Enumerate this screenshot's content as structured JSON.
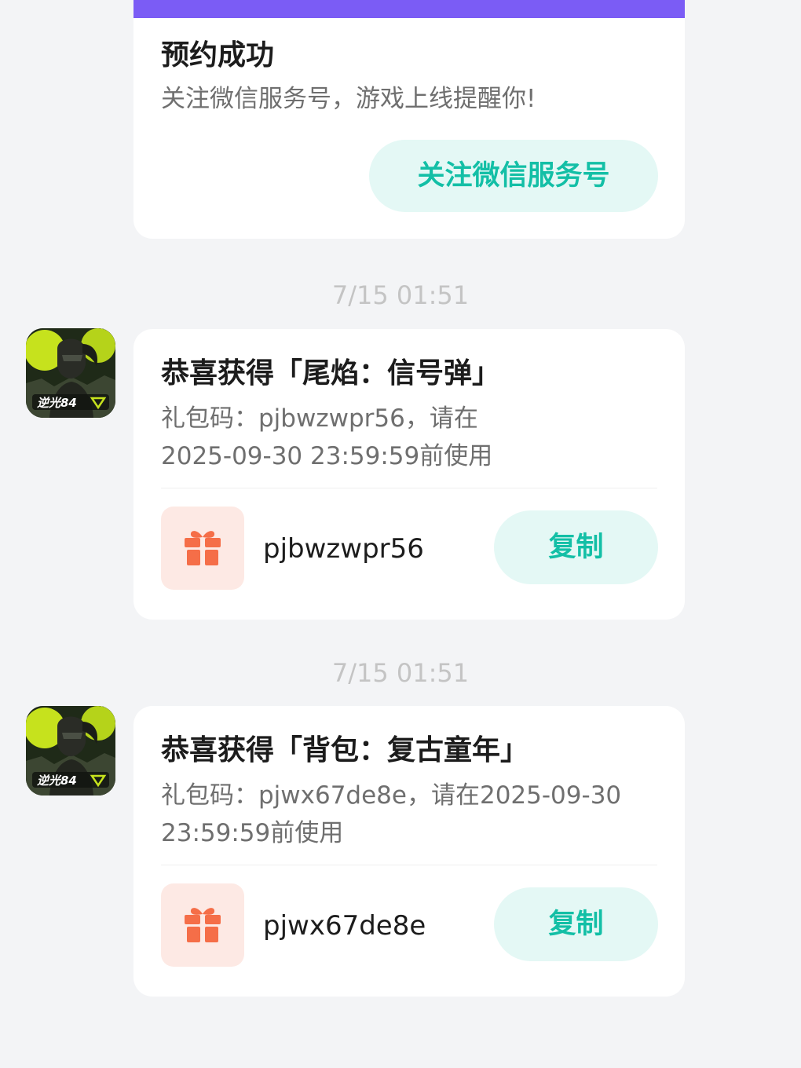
{
  "reservation": {
    "title": "预约成功",
    "subtitle": "关注微信服务号，游戏上线提醒你!",
    "follow_button": "关注微信服务号"
  },
  "colors": {
    "accent": "#13bfa6",
    "accent_bg": "#e4f8f5",
    "top_bar": "#7b5cf5",
    "gift_icon": "#f56e48",
    "gift_bg": "#fde9e4"
  },
  "avatar_icon": "game-app-icon",
  "messages": [
    {
      "time": "7/15  01:51",
      "title": "恭喜获得「尾焰：信号弹」",
      "desc_line1": "礼包码：pjbwzwpr56，请在",
      "desc_line2": "2025-09-30 23:59:59前使用",
      "code": "pjbwzwpr56",
      "copy_label": "复制",
      "avatar_text": "逆光84"
    },
    {
      "time": "7/15  01:51",
      "title": "恭喜获得「背包：复古童年」",
      "desc_line1": "礼包码：pjwx67de8e，请在2025-09-30",
      "desc_line2": "23:59:59前使用",
      "code": "pjwx67de8e",
      "copy_label": "复制",
      "avatar_text": "逆光84"
    }
  ]
}
